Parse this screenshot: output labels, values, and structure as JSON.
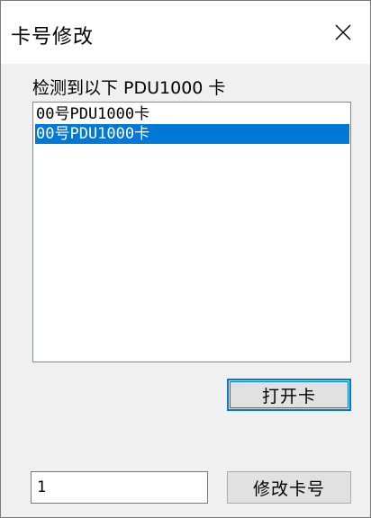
{
  "window": {
    "title": "卡号修改"
  },
  "detect": {
    "label": "检测到以下 PDU1000 卡"
  },
  "list": {
    "items": [
      {
        "label": "00号PDU1000卡",
        "selected": false
      },
      {
        "label": "00号PDU1000卡",
        "selected": true
      }
    ]
  },
  "buttons": {
    "open_label": "打开卡",
    "modify_label": "修改卡号"
  },
  "card_number_input": {
    "value": "1"
  },
  "colors": {
    "selection": "#0078d7",
    "button_face": "#e1e1e1",
    "window_bg": "#f0f0f0"
  },
  "icons": {
    "close": "close-icon"
  }
}
